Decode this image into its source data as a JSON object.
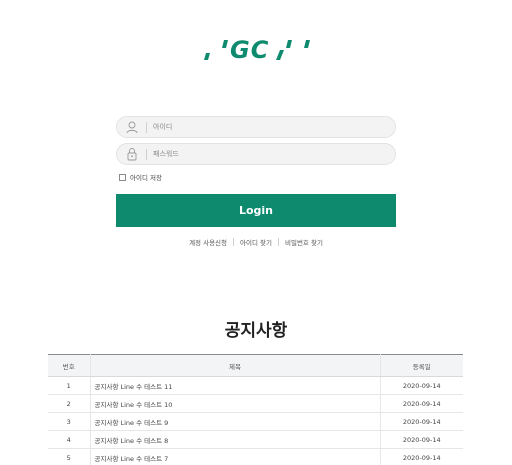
{
  "brand": {
    "logo_text": "GC",
    "color": "#0e8b6e"
  },
  "login": {
    "id_placeholder": "아이디",
    "pw_placeholder": "패스워드",
    "remember_label": "아이디 저장",
    "submit_label": "Login"
  },
  "links": {
    "apply": "계정 사용신청",
    "find_id": "아이디 찾기",
    "find_pw": "비밀번호 찾기"
  },
  "notice": {
    "title": "공지사항",
    "columns": [
      "번호",
      "제목",
      "등록일"
    ],
    "rows": [
      {
        "no": "1",
        "title": "공지사항 Line 수 테스트 11",
        "date": "2020-09-14"
      },
      {
        "no": "2",
        "title": "공지사항 Line 수 테스트 10",
        "date": "2020-09-14"
      },
      {
        "no": "3",
        "title": "공지사항 Line 수 테스트 9",
        "date": "2020-09-14"
      },
      {
        "no": "4",
        "title": "공지사항 Line 수 테스트 8",
        "date": "2020-09-14"
      },
      {
        "no": "5",
        "title": "공지사항 Line 수 테스트 7",
        "date": "2020-09-14"
      }
    ]
  }
}
